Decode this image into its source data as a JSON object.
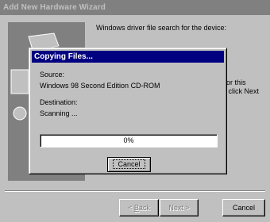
{
  "window": {
    "title": "Add New Hardware Wizard"
  },
  "wizard": {
    "heading": "Windows driver file search for the device:",
    "side_text_line1": "er for this",
    "side_text_line2": ", or click Next",
    "buttons": {
      "back_prefix": "< ",
      "back_mnemonic": "B",
      "back_rest": "ack",
      "next_prefix": "Next",
      "next_suffix": " >",
      "cancel": "Cancel"
    }
  },
  "copy_dialog": {
    "title": "Copying Files...",
    "source_label": "Source:",
    "source_value": "Windows 98 Second Edition CD-ROM",
    "destination_label": "Destination:",
    "status": "Scanning ...",
    "progress_percent": 0,
    "progress_text": "0%",
    "cancel_label": "Cancel"
  },
  "colors": {
    "face": "#c0c0c0",
    "inactive_title": "#808080",
    "active_title": "#000080"
  }
}
